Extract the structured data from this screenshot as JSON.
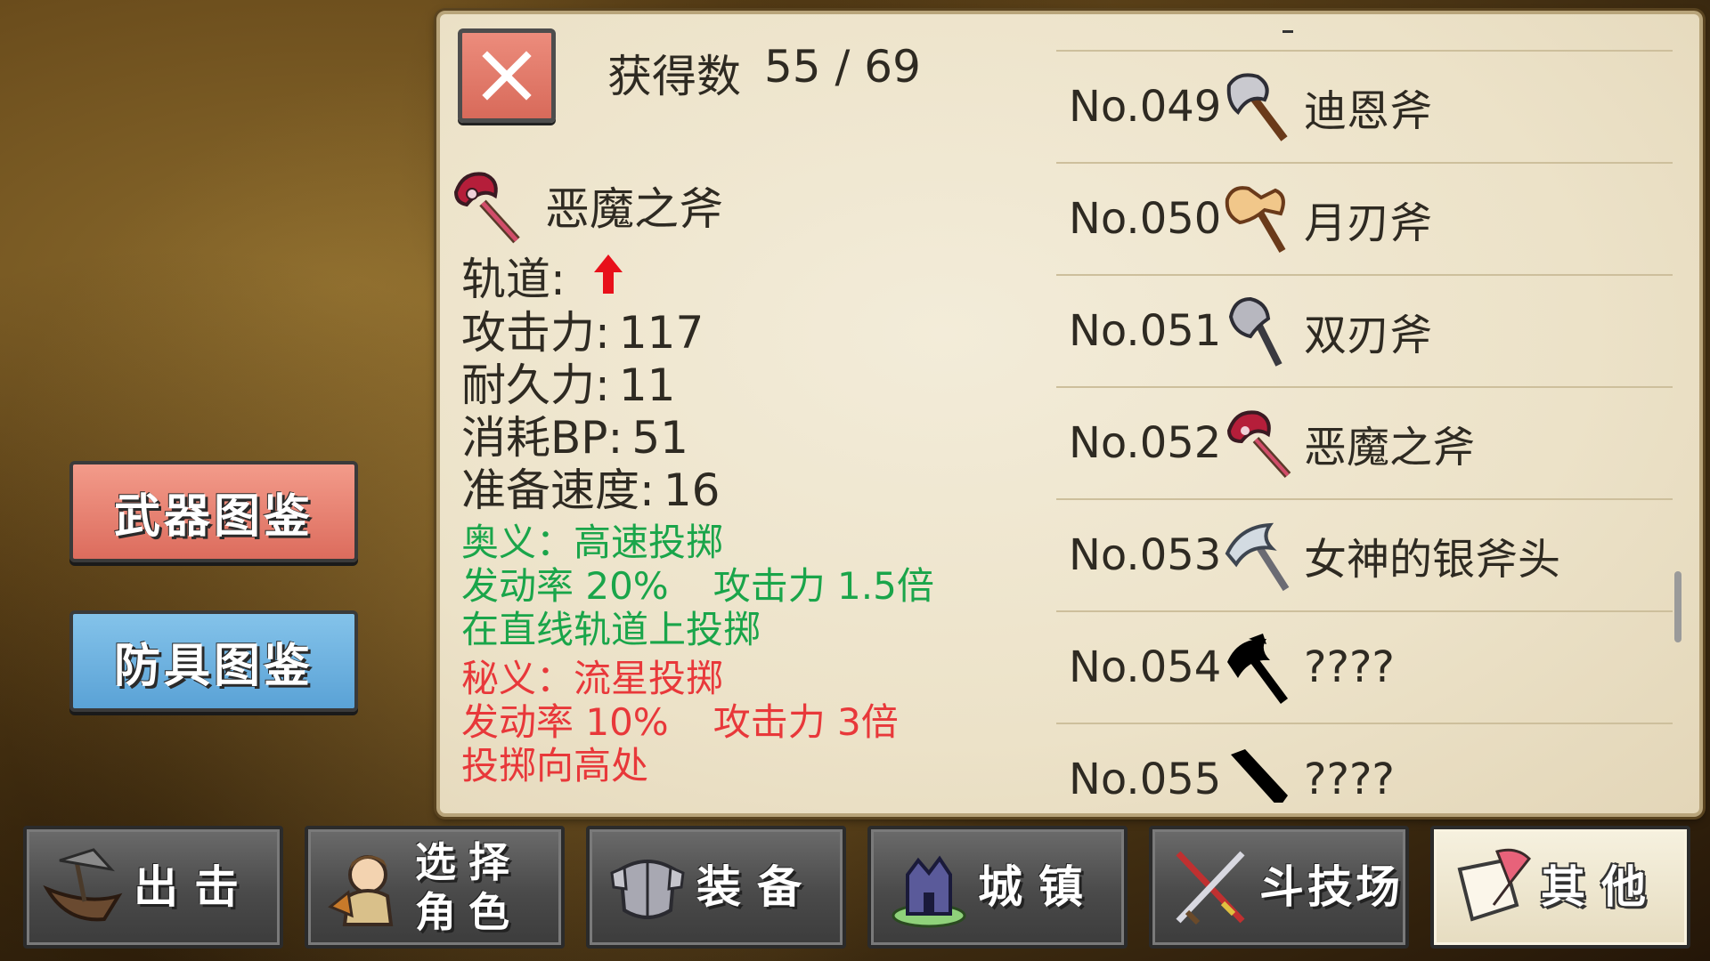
{
  "header": {
    "close_icon": "close-x-icon",
    "acquired_label": "获得数",
    "acquired_count": "55 / 69"
  },
  "detail": {
    "name": "恶魔之斧",
    "icon": "demon-axe-icon",
    "trajectory_label": "轨道:",
    "trajectory_icon": "red-up-arrow-icon",
    "attack_label": "攻击力:",
    "attack_value": "117",
    "durability_label": "耐久力:",
    "durability_value": "11",
    "bp_label": "消耗BP:",
    "bp_value": "51",
    "prep_label": "准备速度:",
    "prep_value": "16"
  },
  "skill_secret": {
    "title": "奥义：高速投掷",
    "rate": "发动率 20%",
    "power": "攻击力 1.5倍",
    "desc": "在直线轨道上投掷",
    "color": "#1aa54a"
  },
  "skill_hidden": {
    "title": "秘义：流星投掷",
    "rate": "发动率 10%",
    "power": "攻击力 3倍",
    "desc": "投掷向高处",
    "color": "#e8383a"
  },
  "list": [
    {
      "no": "No.049",
      "name": "迪恩斧",
      "icon": "dean-axe-icon"
    },
    {
      "no": "No.050",
      "name": "月刃斧",
      "icon": "moon-blade-axe-icon"
    },
    {
      "no": "No.051",
      "name": "双刃斧",
      "icon": "double-blade-axe-icon"
    },
    {
      "no": "No.052",
      "name": "恶魔之斧",
      "icon": "demon-axe-icon"
    },
    {
      "no": "No.053",
      "name": "女神的银斧头",
      "icon": "silver-axe-icon"
    },
    {
      "no": "No.054",
      "name": "????",
      "icon": "unknown-silhouette-icon"
    },
    {
      "no": "No.055",
      "name": "????",
      "icon": "unknown-silhouette-icon"
    }
  ],
  "side": {
    "weapons_label": "武器图鉴",
    "armor_label": "防具图鉴"
  },
  "nav": {
    "sortie": "出击",
    "character_line1": "选择",
    "character_line2": "角色",
    "equip": "装备",
    "town": "城镇",
    "arena": "斗技场",
    "other": "其他"
  }
}
